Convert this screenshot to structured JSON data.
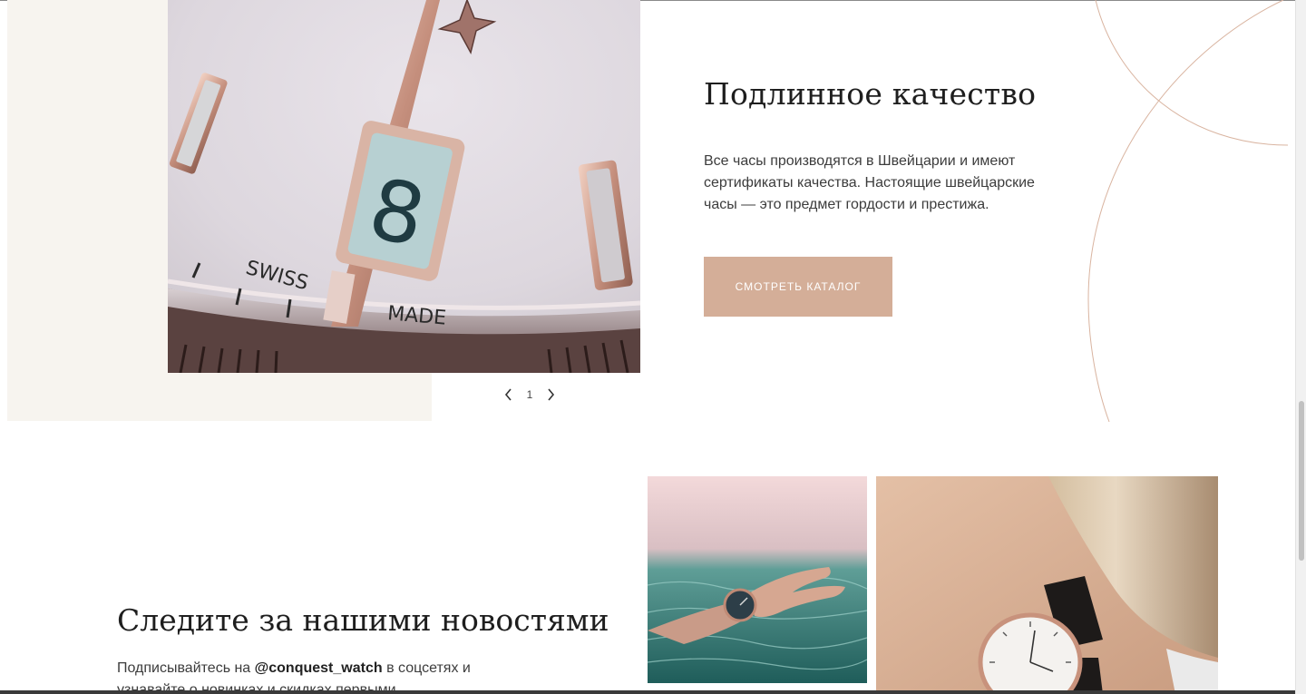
{
  "quality": {
    "title": "Подлинное качество",
    "text": "Все часы производятся в Швейцарии и имеют сертификаты качества. Настоящие швейцарские часы — это предмет гордости и престижа.",
    "button_label": "СМОТРЕТЬ КАТАЛОГ",
    "photo_text": {
      "word_left": "SWISS",
      "word_right": "MADE",
      "date_digit": "8"
    },
    "pager": {
      "current": "1",
      "prev_icon": "chevron-left-icon",
      "next_icon": "chevron-right-icon"
    }
  },
  "news": {
    "title": "Следите за нашими новостями",
    "text_prefix": "Подписывайтесь на ",
    "handle": "@conquest_watch",
    "text_suffix": " в соцсетях и узнавайте о новинках и скидках первыми"
  },
  "colors": {
    "accent": "#d4ae98",
    "beige_panel": "#f7f4ef",
    "deco_line": "#d9b4a0"
  }
}
